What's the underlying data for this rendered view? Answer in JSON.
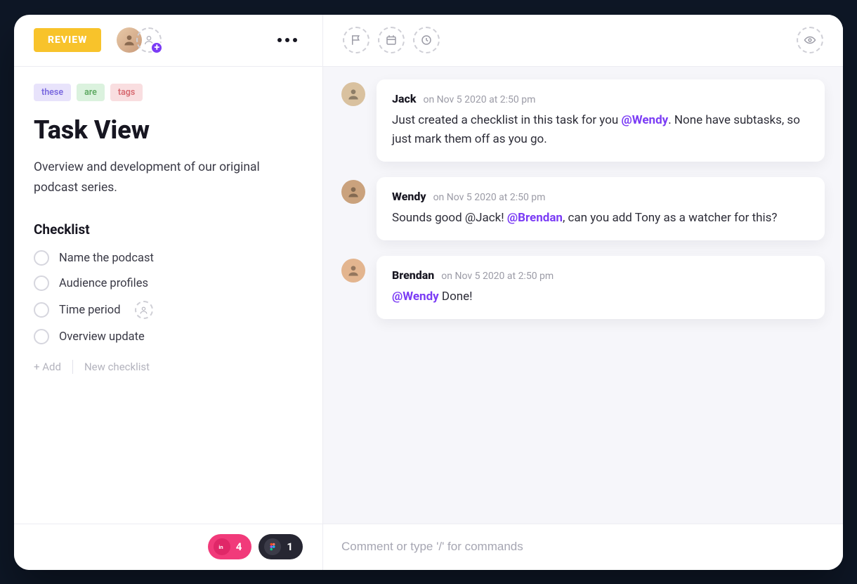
{
  "status": "REVIEW",
  "tags": [
    {
      "text": "these",
      "cls": "tag-purple"
    },
    {
      "text": "are",
      "cls": "tag-green"
    },
    {
      "text": "tags",
      "cls": "tag-red"
    }
  ],
  "title": "Task View",
  "description": "Overview and development of our original podcast series.",
  "checklist": {
    "heading": "Checklist",
    "items": [
      "Name the podcast",
      "Audience profiles",
      "Time period",
      "Overview update"
    ],
    "add_label": "+ Add",
    "new_label": "New checklist"
  },
  "integrations": {
    "invision_count": "4",
    "figma_count": "1"
  },
  "comments": [
    {
      "author": "Jack",
      "time": "on Nov 5 2020 at 2:50 pm",
      "segments": [
        {
          "t": "Just created a checklist in this task for you "
        },
        {
          "t": "@Wendy",
          "m": true
        },
        {
          "t": ". None have subtasks, so just mark them off as you go."
        }
      ]
    },
    {
      "author": "Wendy",
      "time": "on Nov 5 2020 at 2:50 pm",
      "segments": [
        {
          "t": "Sounds good @Jack! "
        },
        {
          "t": "@Brendan",
          "m": true
        },
        {
          "t": ", can you add Tony as a watcher for this?"
        }
      ]
    },
    {
      "author": "Brendan",
      "time": "on Nov 5 2020 at 2:50 pm",
      "segments": [
        {
          "t": "@Wendy",
          "m": true
        },
        {
          "t": " Done!"
        }
      ]
    }
  ],
  "composer_placeholder": "Comment or type '/' for commands"
}
